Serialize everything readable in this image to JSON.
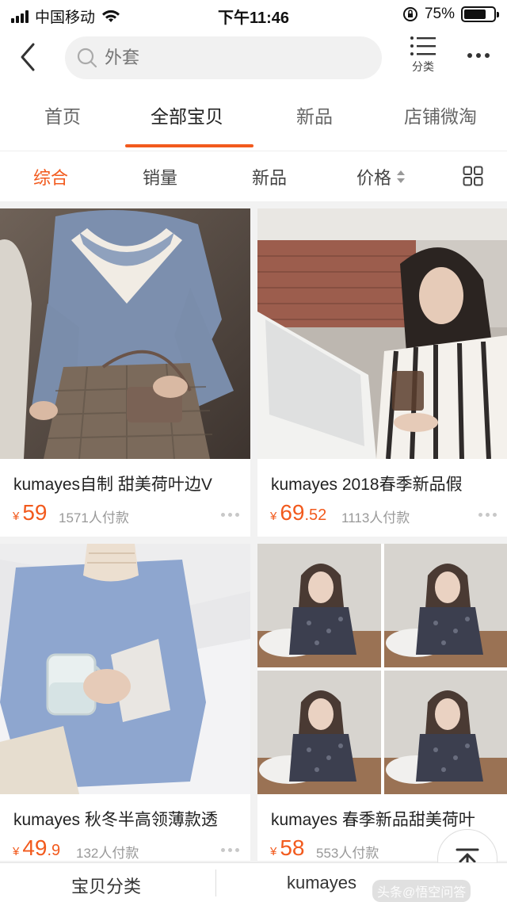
{
  "status_bar": {
    "carrier": "中国移动",
    "time": "下午11:46",
    "battery": "75%",
    "battery_level": 0.75
  },
  "header": {
    "search": {
      "placeholder": "外套"
    },
    "category_label": "分类"
  },
  "tabs": [
    {
      "label": "首页",
      "active": false
    },
    {
      "label": "全部宝贝",
      "active": true
    },
    {
      "label": "新品",
      "active": false
    },
    {
      "label": "店铺微淘",
      "active": false
    }
  ],
  "sort": {
    "options": [
      {
        "label": "综合",
        "active": true
      },
      {
        "label": "销量",
        "active": false
      },
      {
        "label": "新品",
        "active": false
      },
      {
        "label": "价格",
        "active": false
      }
    ]
  },
  "accent_color": "#f25a1d",
  "products": [
    {
      "title": "kumayes自制 甜美荷叶边V",
      "currency": "¥",
      "price_int": "59",
      "price_dec": "",
      "paid": "1571人付款"
    },
    {
      "title": "kumayes 2018春季新品假",
      "currency": "¥",
      "price_int": "69",
      "price_dec": ".52",
      "paid": "1113人付款"
    },
    {
      "title": "kumayes 秋冬半高领薄款透",
      "currency": "¥",
      "price_int": "49",
      "price_dec": ".9",
      "paid": "132人付款"
    },
    {
      "title": "kumayes 春季新品甜美荷叶",
      "currency": "¥",
      "price_int": "58",
      "price_dec": "",
      "paid": "553人付款"
    }
  ],
  "bottom_bar": {
    "category": "宝贝分类",
    "shop": "kumayes"
  },
  "watermark": "头条@悟空问答"
}
